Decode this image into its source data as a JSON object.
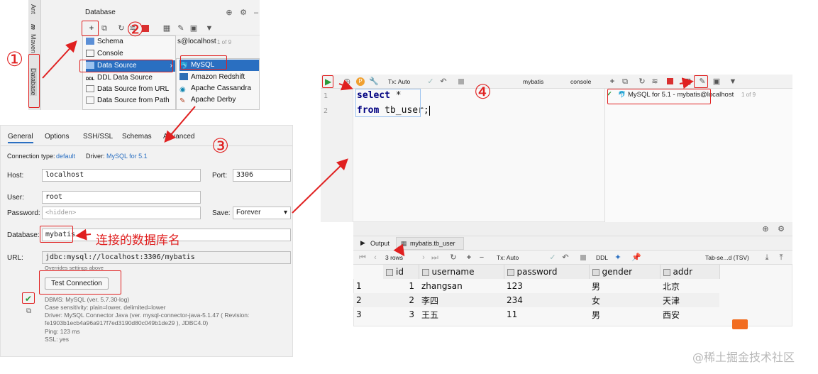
{
  "db_panel": {
    "side_tabs": [
      "Ant",
      "m",
      "Maven",
      "Database"
    ],
    "title": "Database",
    "connection_label": "s@localhost",
    "connection_count": "1 of 9",
    "menu_left": [
      "Schema",
      "Console",
      "Data Source",
      "DDL Data Source",
      "Data Source from URL",
      "Data Source from Path"
    ],
    "menu_right": [
      "MySQL",
      "Amazon Redshift",
      "Apache Cassandra",
      "Apache Derby"
    ]
  },
  "annotations": {
    "step1": "①",
    "step2": "②",
    "step3": "③",
    "step4": "④",
    "db_name_note": "连接的数据库名"
  },
  "ds_panel": {
    "tabs": [
      "General",
      "Options",
      "SSH/SSL",
      "Schemas",
      "Advanced"
    ],
    "connection_type_label": "Connection type:",
    "connection_type_value": "default",
    "driver_label": "Driver:",
    "driver_value": "MySQL for 5.1",
    "host_label": "Host:",
    "host_value": "localhost",
    "port_label": "Port:",
    "port_value": "3306",
    "user_label": "User:",
    "user_value": "root",
    "password_label": "Password:",
    "password_value": "<hidden>",
    "save_label": "Save:",
    "save_value": "Forever",
    "database_label": "Database:",
    "database_value": "mybatis",
    "url_label": "URL:",
    "url_value": "jdbc:mysql://localhost:3306/mybatis",
    "url_note": "Overrides settings above",
    "test_button": "Test Connection",
    "info_lines": [
      "DBMS: MySQL (ver. 5.7.30-log)",
      "Case sensitivity: plain=lower, delimited=lower",
      "Driver: MySQL Connector Java (ver. mysql-connector-java-5.1.47 ( Revision:",
      "fe1903b1ecb4a96a917f7ed3190d80c049b1de29 ), JDBC4.0)",
      "Ping: 123 ms",
      "SSL: yes"
    ]
  },
  "editor": {
    "tx_label": "Tx: Auto",
    "schema_label": "mybatis",
    "console_label": "console",
    "lines": [
      "1",
      "2"
    ],
    "code": [
      {
        "kw": "select",
        "rest": " *"
      },
      {
        "kw": "from",
        "rest": " tb_user;"
      }
    ],
    "right_connection": "MySQL for 5.1 - mybatis@localhost",
    "right_count": "1 of 9"
  },
  "results": {
    "output_tab": "Output",
    "table_tab": "mybatis.tb_user",
    "rows_label": "3 rows",
    "tx_label": "Tx: Auto",
    "ddl_label": "DDL",
    "export_label": "Tab-se...d (TSV)",
    "columns": [
      "id",
      "username",
      "password",
      "gender",
      "addr"
    ],
    "rows": [
      {
        "n": "1",
        "id": "1",
        "username": "zhangsan",
        "password": "123",
        "gender": "男",
        "addr": "北京"
      },
      {
        "n": "2",
        "id": "2",
        "username": "李四",
        "password": "234",
        "gender": "女",
        "addr": "天津"
      },
      {
        "n": "3",
        "id": "3",
        "username": "王五",
        "password": "11",
        "gender": "男",
        "addr": "西安"
      }
    ]
  },
  "watermark": "@稀土掘金技术社区",
  "colors": {
    "annotation_red": "#e02020",
    "selection_blue": "#2a6fc1",
    "link_blue": "#2a6fc1"
  }
}
